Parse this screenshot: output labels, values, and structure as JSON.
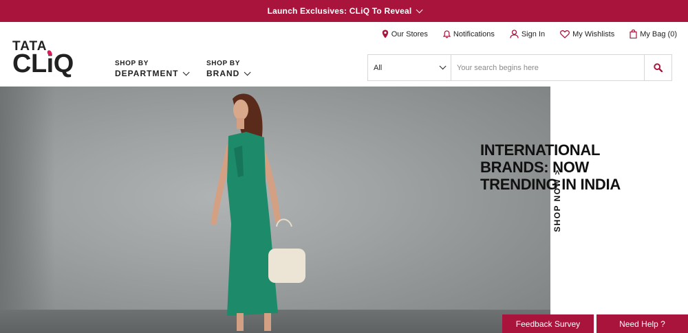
{
  "announcement": {
    "text": "Launch Exclusives: CLiQ To Reveal"
  },
  "logo": {
    "line1": "TATA",
    "line2": "CLiQ"
  },
  "shop_by": [
    {
      "small": "SHOP BY",
      "big": "DEPARTMENT"
    },
    {
      "small": "SHOP BY",
      "big": "BRAND"
    }
  ],
  "utility_nav": [
    {
      "label": "Our Stores",
      "icon": "location-pin-icon"
    },
    {
      "label": "Notifications",
      "icon": "bell-icon"
    },
    {
      "label": "Sign In",
      "icon": "user-icon"
    },
    {
      "label": "My Wishlists",
      "icon": "heart-icon"
    },
    {
      "label": "My Bag (0)",
      "icon": "bag-icon"
    }
  ],
  "search": {
    "category": "All",
    "placeholder": "Your search begins here",
    "value": ""
  },
  "hero": {
    "headline_lines": [
      "INTERNATIONAL",
      "BRANDS: NOW",
      "TRENDING IN INDIA"
    ],
    "cta": "SHOP NOW >"
  },
  "floating": {
    "feedback": "Feedback Survey",
    "help": "Need Help ?"
  },
  "colors": {
    "brand": "#a9143c",
    "accent": "#da1c5c",
    "text": "#212121"
  }
}
